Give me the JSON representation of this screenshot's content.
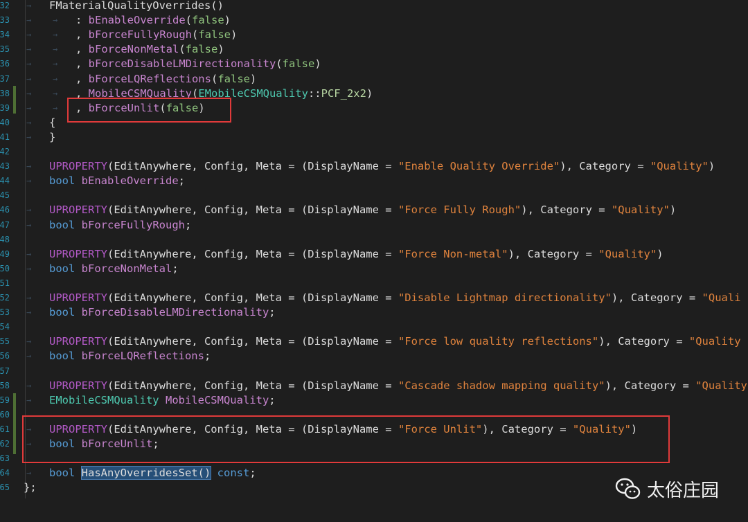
{
  "line_numbers": [
    "32",
    "33",
    "34",
    "35",
    "36",
    "37",
    "38",
    "39",
    "40",
    "41",
    "42",
    "43",
    "44",
    "45",
    "46",
    "47",
    "48",
    "49",
    "50",
    "51",
    "52",
    "53",
    "54",
    "55",
    "56",
    "57",
    "58",
    "59",
    "60",
    "61",
    "62",
    "63",
    "64",
    "65"
  ],
  "code": {
    "ctor_name": "FMaterialQualityOverrides()",
    "init_1": ": bEnableOverride(false)",
    "init_2": ", bForceFullyRough(false)",
    "init_3": ", bForceNonMetal(false)",
    "init_4": ", bForceDisableLMDirectionality(false)",
    "init_5": ", bForceLQReflections(false)",
    "init_6": ", MobileCSMQuality(EMobileCSMQuality::PCF_2x2)",
    "init_7": ", bForceUnlit(false)",
    "open_brace": "{",
    "close_brace": "}",
    "prop_1_decl": "UPROPERTY(EditAnywhere, Config, Meta = (DisplayName = \"Enable Quality Override\"), Category = \"Quality\")",
    "prop_1_var": "bool bEnableOverride;",
    "prop_2_decl": "UPROPERTY(EditAnywhere, Config, Meta = (DisplayName = \"Force Fully Rough\"), Category = \"Quality\")",
    "prop_2_var": "bool bForceFullyRough;",
    "prop_3_decl": "UPROPERTY(EditAnywhere, Config, Meta = (DisplayName = \"Force Non-metal\"), Category = \"Quality\")",
    "prop_3_var": "bool bForceNonMetal;",
    "prop_4_decl": "UPROPERTY(EditAnywhere, Config, Meta = (DisplayName = \"Disable Lightmap directionality\"), Category = \"Quali",
    "prop_4_var": "bool bForceDisableLMDirectionality;",
    "prop_5_decl": "UPROPERTY(EditAnywhere, Config, Meta = (DisplayName = \"Force low quality reflections\"), Category = \"Quality",
    "prop_5_var": "bool bForceLQReflections;",
    "prop_6_decl": "UPROPERTY(EditAnywhere, Config, Meta = (DisplayName = \"Cascade shadow mapping quality\"), Category = \"Quality",
    "prop_6_var": "EMobileCSMQuality MobileCSMQuality;",
    "prop_7_decl": "UPROPERTY(EditAnywhere, Config, Meta = (DisplayName = \"Force Unlit\"), Category = \"Quality\")",
    "prop_7_var": "bool bForceUnlit;",
    "method": "bool HasAnyOverridesSet() const;",
    "struct_end": "};"
  },
  "watermark": {
    "text": "太俗庄园"
  },
  "colors": {
    "highlight_box": "#e03a3a",
    "background": "#1e1e1e",
    "string": "#e0833d",
    "macro": "#b45ac8"
  }
}
